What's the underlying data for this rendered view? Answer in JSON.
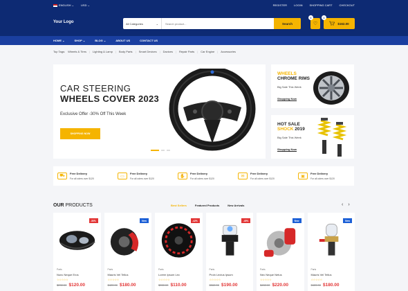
{
  "topbar": {
    "language": "ENGLISH",
    "currency": "USD",
    "links": [
      "REGISTER",
      "LOGIN",
      "SHOPPING CART",
      "CHECKOUT"
    ]
  },
  "header": {
    "logo": "Your Logo",
    "category": "All Categories",
    "placeholder": "Search product...",
    "search_button": "Search",
    "wishlist_count": "0",
    "cart_count": "0",
    "cart_total": "$162.00"
  },
  "nav": [
    {
      "label": "HOME"
    },
    {
      "label": "SHOP"
    },
    {
      "label": "BLOG"
    },
    {
      "label": "ABOUT US"
    },
    {
      "label": "CONTACT US"
    }
  ],
  "tags": {
    "label": "Top Tags:",
    "items": [
      "Wheels & Tires",
      "Lighting & Lamp",
      "Body Parts",
      "Smart Devices",
      "Davices",
      "Repair Parts",
      "Car Engine",
      "Accessories"
    ]
  },
  "hero": {
    "line1": "CAR STEERING",
    "line2": "WHEELS COVER 2023",
    "offer": "Exclusive Offer -30% Off This Week",
    "button": "SHOPPING NOW"
  },
  "side1": {
    "title_a": "WHEELS",
    "title_b": "CHROME RIMS",
    "sub": "Big Sale This Week",
    "link": "Shopping Now"
  },
  "side2": {
    "title_a": "HOT SALE",
    "title_b": "SHOCK",
    "title_c": "2019",
    "sub": "Big Sale This Week",
    "link": "Shopping Now"
  },
  "features": [
    {
      "title": "Free Delivery",
      "sub": "For all oders over $120"
    },
    {
      "title": "Free Delivery",
      "sub": "For all oders over $120"
    },
    {
      "title": "Free Delivery",
      "sub": "For all oders over $120"
    },
    {
      "title": "Free Delivery",
      "sub": "For all oders over $120"
    },
    {
      "title": "Free Delivery",
      "sub": "For all oders over $120"
    }
  ],
  "products_section": {
    "title_a": "OUR",
    "title_b": "PRODUCTS",
    "tabs": [
      "Best Sellers",
      "Featured Products",
      "New Arrivals"
    ]
  },
  "products": [
    {
      "badge": "-50%",
      "badge_type": "sale",
      "category": "Parts",
      "name": "Nunc Neque Eros",
      "old": "$230.00",
      "price": "$120.00",
      "rating": 0
    },
    {
      "badge": "New",
      "badge_type": "new",
      "category": "Parts",
      "name": "Mauris Vel Tellus",
      "old": "$420.00",
      "price": "$180.00",
      "rating": 0
    },
    {
      "badge": "-42%",
      "badge_type": "sale",
      "category": "Parts",
      "name": "Lorem Ipsum Lec",
      "old": "$330.00",
      "price": "$110.00",
      "rating": 0
    },
    {
      "badge": "-45%",
      "badge_type": "sale",
      "category": "Parts",
      "name": "Proin Lectus Ipsum",
      "old": "$360.00",
      "price": "$190.00",
      "rating": 0
    },
    {
      "badge": "New",
      "badge_type": "new",
      "category": "Parts",
      "name": "Nec Neque Netus",
      "old": "$450.00",
      "price": "$220.00",
      "rating": 0
    },
    {
      "badge": "New",
      "badge_type": "new",
      "category": "Parts",
      "name": "Mauris Vel Tellus",
      "old": "$420.00",
      "price": "$180.00",
      "rating": 0
    }
  ],
  "colors": {
    "navy": "#0d2a73",
    "nav": "#1a3fa0",
    "accent": "#f5b400",
    "sale": "#e23535",
    "new": "#1b5fd6"
  }
}
